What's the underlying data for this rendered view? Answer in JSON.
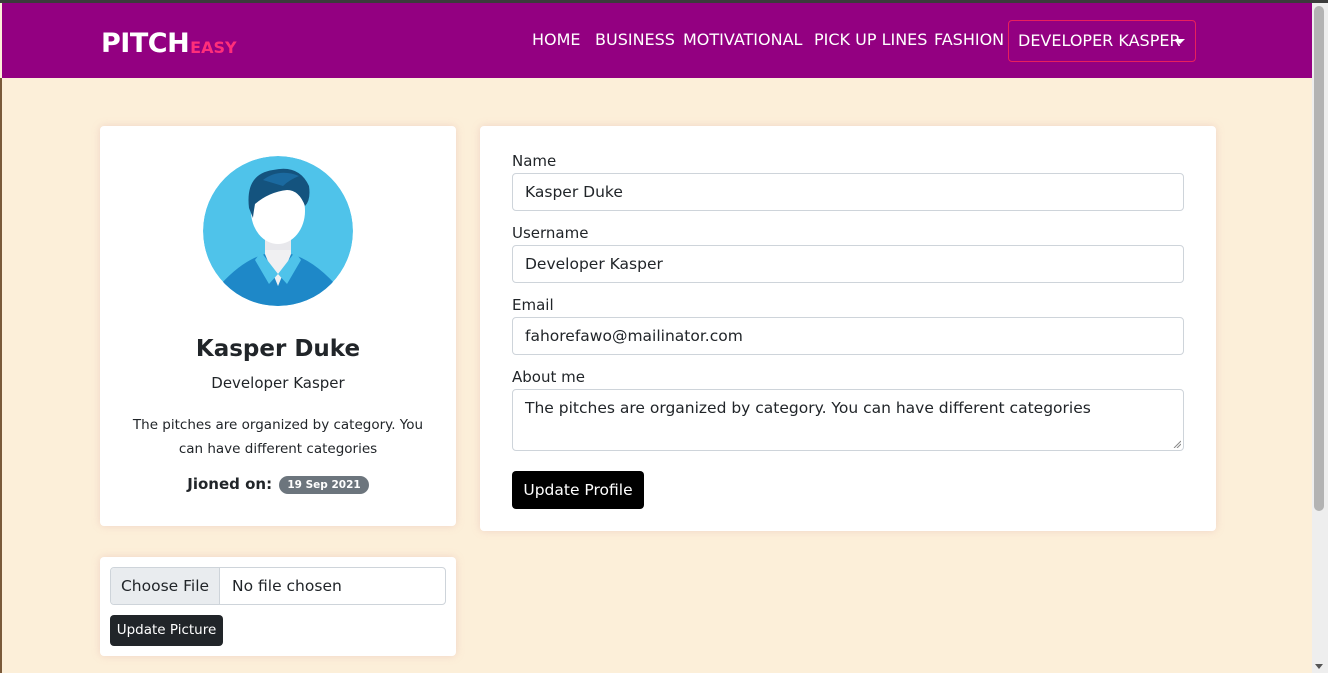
{
  "brand": {
    "main": "PITCH",
    "sub": "EASY"
  },
  "nav": {
    "links": [
      "HOME",
      "BUSINESS",
      "MOTIVATIONAL",
      "PICK UP LINES",
      "FASHION"
    ],
    "user_menu": "DEVELOPER KASPER"
  },
  "profile": {
    "name": "Kasper Duke",
    "username": "Developer Kasper",
    "bio": "The pitches are organized by category. You can have different categories",
    "joined_label": "Jioned on:",
    "joined_date": "19 Sep 2021"
  },
  "picture_form": {
    "choose_file_label": "Choose File",
    "file_status": "No file chosen",
    "submit_label": "Update Picture"
  },
  "profile_form": {
    "name_label": "Name",
    "name_value": "Kasper Duke",
    "username_label": "Username",
    "username_value": "Developer Kasper",
    "email_label": "Email",
    "email_value": "fahorefawo@mailinator.com",
    "about_label": "About me",
    "about_value": "The pitches are organized by category. You can have different categories",
    "submit_label": "Update Profile"
  },
  "colors": {
    "navbar": "#930081",
    "brand_accent": "#ff2e7a",
    "page_bg": "#fcefd9",
    "avatar_bg": "#4fc3ea"
  }
}
